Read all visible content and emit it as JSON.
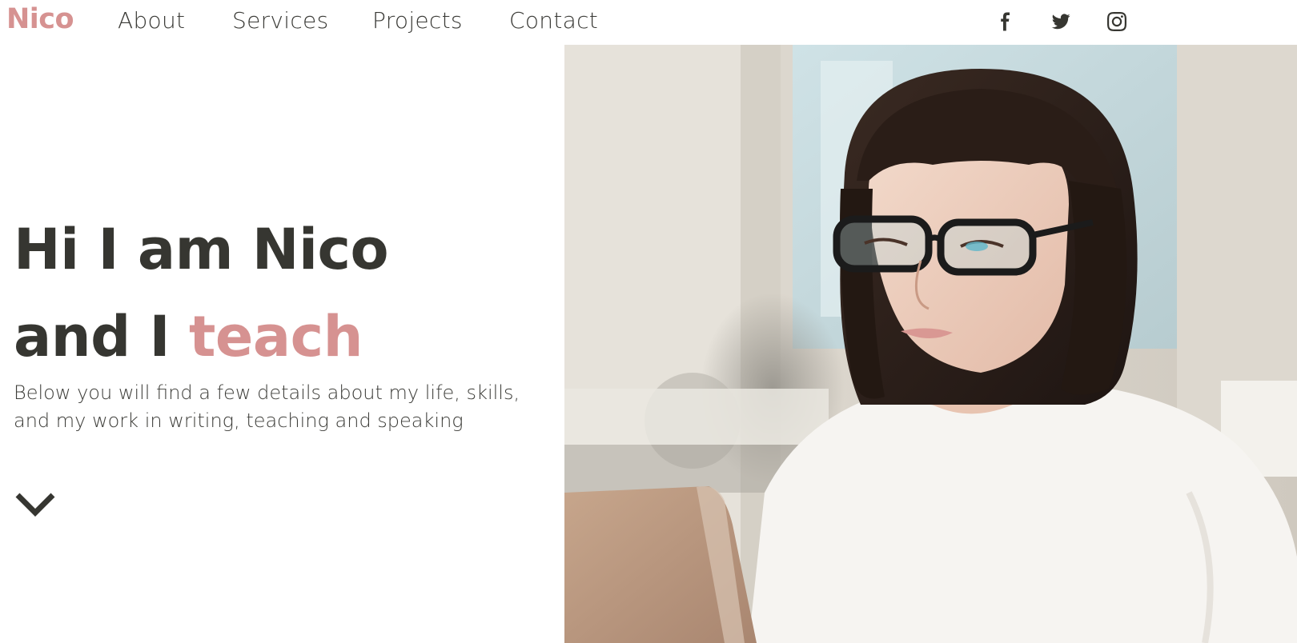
{
  "nav": {
    "brand": "Nico",
    "links": [
      "About",
      "Services",
      "Projects",
      "Contact"
    ],
    "social": [
      {
        "name": "facebook-icon"
      },
      {
        "name": "twitter-icon"
      },
      {
        "name": "instagram-icon"
      }
    ]
  },
  "hero": {
    "line1": "Hi I am Nico",
    "line2_prefix": "and I ",
    "line2_accent": "teach",
    "subtitle_line1": "Below you will find a few details about my life, skills,",
    "subtitle_line2": "and my work in writing, teaching and speaking",
    "scroll_icon": "chevron-down-icon"
  },
  "colors": {
    "accent": "#d69291",
    "text": "#363631",
    "background": "#ffffff"
  }
}
